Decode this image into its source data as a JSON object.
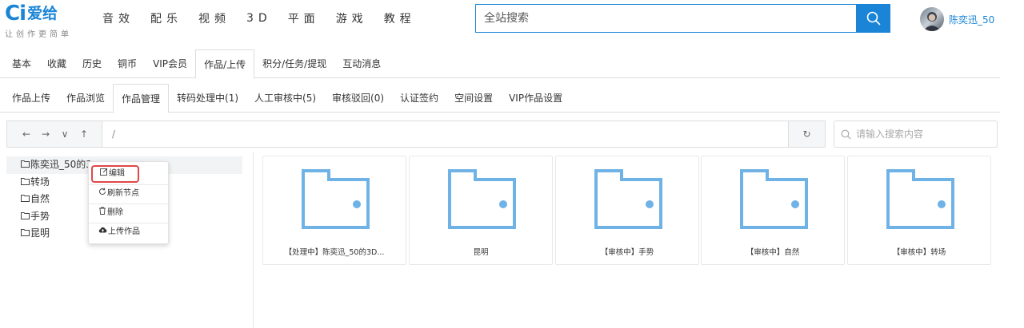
{
  "brand": {
    "logo_mark": "Ci",
    "name": "爱给",
    "slogan": "让创作更简单",
    "accent": "#1a85d6"
  },
  "topnav": [
    "音效",
    "配乐",
    "视频",
    "3D",
    "平面",
    "游戏",
    "教程"
  ],
  "search": {
    "placeholder": "全站搜索"
  },
  "user": {
    "name": "陈奕迅_50"
  },
  "tabs_main": [
    {
      "label": "基本"
    },
    {
      "label": "收藏"
    },
    {
      "label": "历史"
    },
    {
      "label": "铜币"
    },
    {
      "label": "VIP会员"
    },
    {
      "label": "作品/上传",
      "active": true
    },
    {
      "label": "积分/任务/提现"
    },
    {
      "label": "互动消息"
    }
  ],
  "tabs_sub": [
    {
      "label": "作品上传"
    },
    {
      "label": "作品浏览"
    },
    {
      "label": "作品管理",
      "active": true
    },
    {
      "label": "转码处理中(1)"
    },
    {
      "label": "人工审核中(5)"
    },
    {
      "label": "审核驳回(0)"
    },
    {
      "label": "认证签约"
    },
    {
      "label": "空间设置"
    },
    {
      "label": "VIP作品设置"
    }
  ],
  "pathbar": {
    "back": "←",
    "forward": "→",
    "down": "∨",
    "up": "↑",
    "path": "/",
    "refresh": "↻"
  },
  "file_search": {
    "placeholder": "请输入搜索内容"
  },
  "tree": [
    {
      "label": "陈奕迅_50的3",
      "selected": true
    },
    {
      "label": "转场"
    },
    {
      "label": "自然"
    },
    {
      "label": "手势"
    },
    {
      "label": "昆明"
    }
  ],
  "context_menu": [
    {
      "icon": "edit-icon",
      "label": "编辑",
      "highlighted": true
    },
    {
      "icon": "refresh-icon",
      "label": "刷新节点"
    },
    {
      "icon": "trash-icon",
      "label": "删除"
    },
    {
      "icon": "cloud-upload-icon",
      "label": "上传作品"
    }
  ],
  "folders": [
    {
      "label": "【处理中】陈奕迅_50的3D..."
    },
    {
      "label": "昆明"
    },
    {
      "label": "【审核中】手势"
    },
    {
      "label": "【审核中】自然"
    },
    {
      "label": "【审核中】转场"
    }
  ],
  "colors": {
    "folder": "#6fb3e6",
    "border": "#dddddd"
  }
}
